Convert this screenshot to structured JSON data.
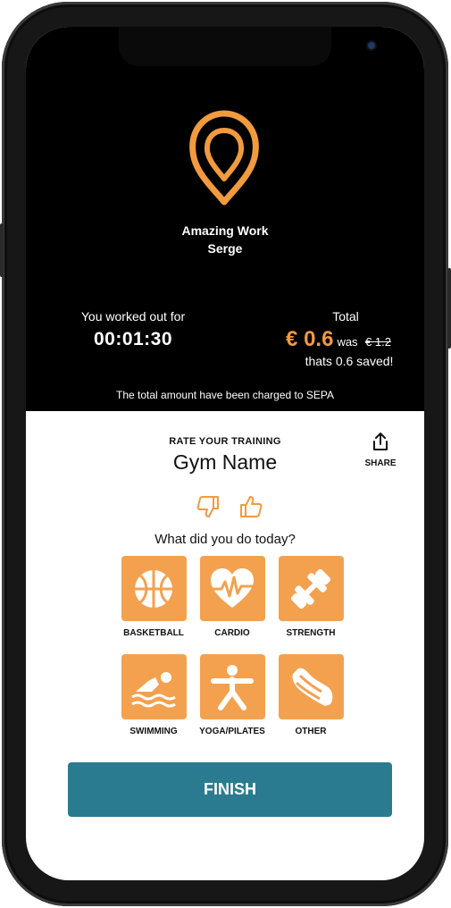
{
  "header": {
    "greeting_line1": "Amazing Work",
    "greeting_line2": "Serge"
  },
  "summary": {
    "worked_label": "You worked out for",
    "duration": "00:01:30",
    "total_label": "Total",
    "price": "€ 0.6",
    "was_prefix": "was",
    "was_price": "€ 1.2",
    "saved_text": "thats 0.6 saved!",
    "charged_text": "The total amount have been charged to SEPA"
  },
  "rating": {
    "title": "RATE YOUR TRAINING",
    "gym_name": "Gym Name",
    "share_label": "SHARE",
    "question": "What did you do today?"
  },
  "activities": [
    {
      "label": "BASKETBALL",
      "icon": "basketball-icon"
    },
    {
      "label": "CARDIO",
      "icon": "heart-pulse-icon"
    },
    {
      "label": "STRENGTH",
      "icon": "dumbbell-icon"
    },
    {
      "label": "SWIMMING",
      "icon": "swimmer-icon"
    },
    {
      "label": "YOGA/PILATES",
      "icon": "yoga-icon"
    },
    {
      "label": "OTHER",
      "icon": "sneaker-icon"
    }
  ],
  "actions": {
    "finish_label": "FINISH"
  },
  "colors": {
    "accent": "#f3a14f",
    "price": "#f19a3e",
    "finish_button": "#2a7b90",
    "top_background": "#000000"
  }
}
